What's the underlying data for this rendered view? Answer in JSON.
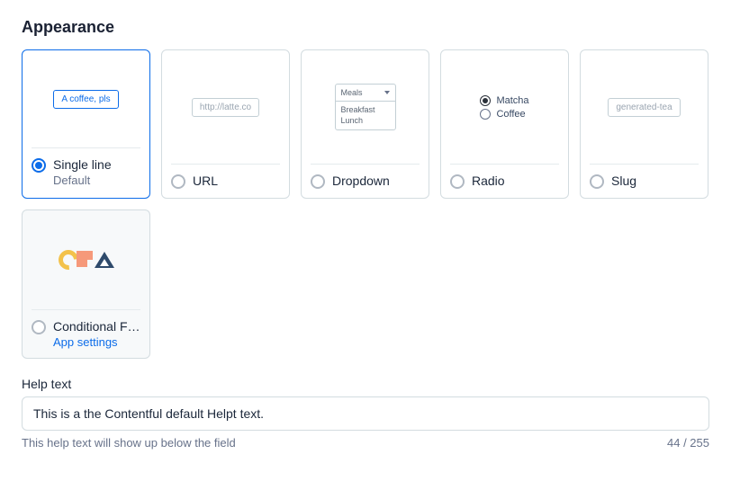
{
  "section_title": "Appearance",
  "options": {
    "single_line": {
      "label": "Single line",
      "sub": "Default",
      "preview_text": "A coffee, pls"
    },
    "url": {
      "label": "URL",
      "preview_text": "http://latte.co"
    },
    "dropdown": {
      "label": "Dropdown",
      "preview_selected": "Meals",
      "preview_opt1": "Breakfast",
      "preview_opt2": "Lunch"
    },
    "radio": {
      "label": "Radio",
      "preview_opt1": "Matcha",
      "preview_opt2": "Coffee"
    },
    "slug": {
      "label": "Slug",
      "preview_text": "generated-tea"
    },
    "conditional": {
      "label": "Conditional Fields",
      "link": "App settings"
    }
  },
  "help": {
    "label": "Help text",
    "value": "This is a the Contentful default Helpt text.",
    "hint": "This help text will show up below the field",
    "counter": "44 / 255"
  }
}
